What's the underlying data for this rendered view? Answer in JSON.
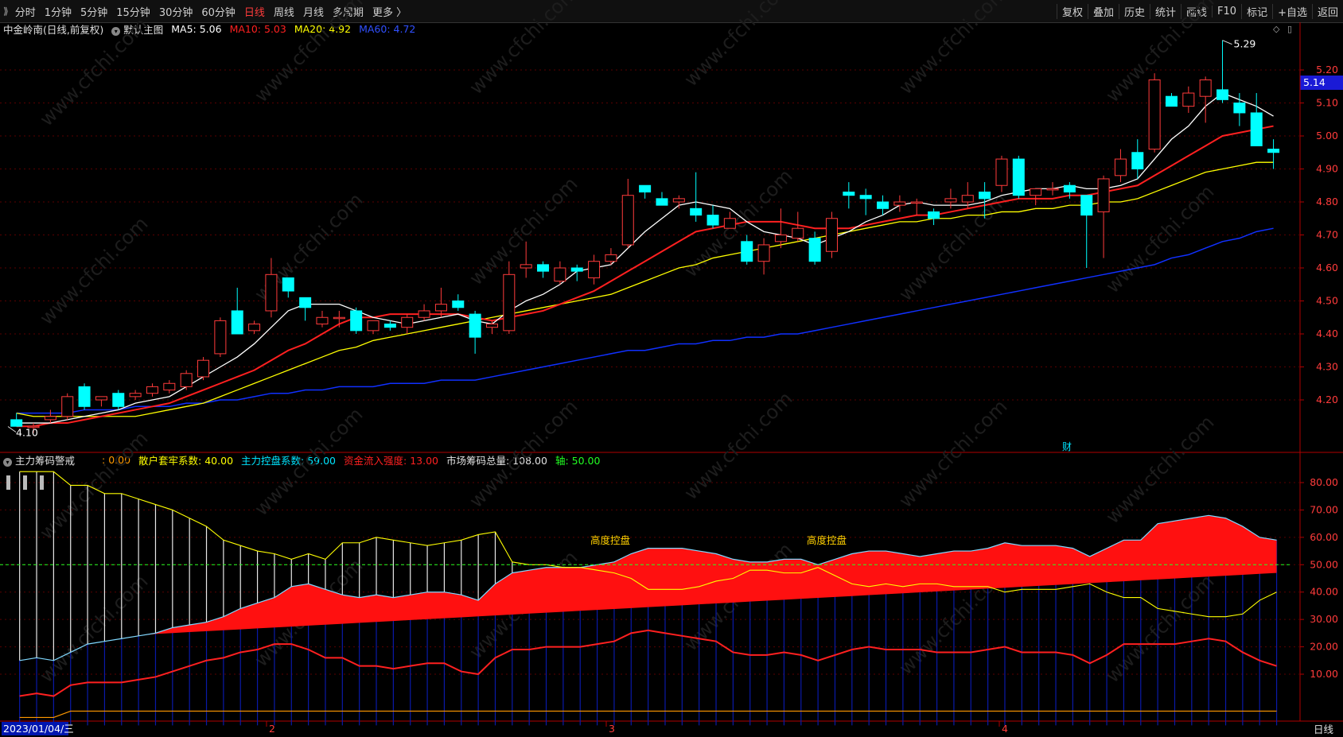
{
  "toolbar": {
    "left": [
      "分时",
      "1分钟",
      "5分钟",
      "15分钟",
      "30分钟",
      "60分钟",
      "日线",
      "周线",
      "月线",
      "多周期",
      "更多 〉"
    ],
    "active_index": 6,
    "right": [
      "复权",
      "叠加",
      "历史",
      "统计",
      "画线",
      "F10",
      "标记",
      "+自选",
      "返回"
    ]
  },
  "main_header": {
    "title": "中金岭南(日线,前复权)",
    "template": "默认主图",
    "ma5": "MA5: 5.06",
    "ma10": "MA10: 5.03",
    "ma20": "MA20: 4.92",
    "ma60": "MA60: 4.72"
  },
  "indicator_header": {
    "name": "主力筹码警戒",
    "v0": ": 0.00",
    "v1": "散户套牢系数: 40.00",
    "v2": "主力控盘系数: 59.00",
    "v3": "资金流入强度: 13.00",
    "v4": "市场筹码总量: 108.00",
    "v5": "轴: 50.00"
  },
  "price_badge": "5.14",
  "high_label": "5.29",
  "low_label": "4.10",
  "finance_marker": "财",
  "annotations": [
    "高度控盘",
    "高度控盘"
  ],
  "x_labels": [
    "2023/01/04/三",
    "2",
    "3",
    "4"
  ],
  "footer_right": "日线",
  "watermark": "www.cfchi.com",
  "colors": {
    "up": "#ff3b3b",
    "down": "#00ffff",
    "ma5": "#ffffff",
    "ma10": "#ff2020",
    "ma20": "#ffff00",
    "ma60": "#1030ff"
  },
  "chart_data": [
    {
      "type": "candlestick",
      "title": "中金岭南(日线,前复权)",
      "y_ticks": [
        4.2,
        4.3,
        4.4,
        4.5,
        4.6,
        4.7,
        4.8,
        4.9,
        5.0,
        5.1,
        5.2
      ],
      "ylim": [
        4.1,
        5.29
      ],
      "ohlc": [
        [
          4.14,
          4.16,
          4.12,
          4.12
        ],
        [
          4.12,
          4.13,
          4.1,
          4.12
        ],
        [
          4.14,
          4.17,
          4.13,
          4.15
        ],
        [
          4.15,
          4.22,
          4.14,
          4.21
        ],
        [
          4.24,
          4.25,
          4.17,
          4.18
        ],
        [
          4.2,
          4.21,
          4.18,
          4.21
        ],
        [
          4.22,
          4.23,
          4.17,
          4.18
        ],
        [
          4.21,
          4.23,
          4.2,
          4.22
        ],
        [
          4.22,
          4.25,
          4.21,
          4.24
        ],
        [
          4.23,
          4.26,
          4.22,
          4.25
        ],
        [
          4.24,
          4.29,
          4.23,
          4.28
        ],
        [
          4.27,
          4.33,
          4.26,
          4.32
        ],
        [
          4.34,
          4.45,
          4.33,
          4.44
        ],
        [
          4.47,
          4.54,
          4.4,
          4.4
        ],
        [
          4.41,
          4.44,
          4.4,
          4.43
        ],
        [
          4.47,
          4.63,
          4.45,
          4.58
        ],
        [
          4.57,
          4.56,
          4.51,
          4.53
        ],
        [
          4.51,
          4.5,
          4.44,
          4.48
        ],
        [
          4.43,
          4.47,
          4.42,
          4.45
        ],
        [
          4.45,
          4.47,
          4.42,
          4.45
        ],
        [
          4.47,
          4.48,
          4.4,
          4.41
        ],
        [
          4.41,
          4.44,
          4.4,
          4.44
        ],
        [
          4.43,
          4.44,
          4.41,
          4.42
        ],
        [
          4.42,
          4.46,
          4.4,
          4.45
        ],
        [
          4.45,
          4.49,
          4.44,
          4.47
        ],
        [
          4.47,
          4.54,
          4.45,
          4.49
        ],
        [
          4.5,
          4.52,
          4.47,
          4.48
        ],
        [
          4.46,
          4.47,
          4.34,
          4.39
        ],
        [
          4.42,
          4.44,
          4.4,
          4.43
        ],
        [
          4.41,
          4.62,
          4.4,
          4.58
        ],
        [
          4.6,
          4.68,
          4.57,
          4.61
        ],
        [
          4.61,
          4.62,
          4.57,
          4.59
        ],
        [
          4.56,
          4.62,
          4.55,
          4.6
        ],
        [
          4.6,
          4.61,
          4.56,
          4.59
        ],
        [
          4.57,
          4.64,
          4.55,
          4.62
        ],
        [
          4.62,
          4.66,
          4.61,
          4.64
        ],
        [
          4.67,
          4.87,
          4.66,
          4.82
        ],
        [
          4.85,
          4.85,
          4.81,
          4.83
        ],
        [
          4.81,
          4.83,
          4.79,
          4.79
        ],
        [
          4.8,
          4.82,
          4.78,
          4.81
        ],
        [
          4.78,
          4.89,
          4.74,
          4.76
        ],
        [
          4.76,
          4.79,
          4.72,
          4.73
        ],
        [
          4.72,
          4.77,
          4.72,
          4.75
        ],
        [
          4.68,
          4.7,
          4.61,
          4.62
        ],
        [
          4.62,
          4.69,
          4.58,
          4.67
        ],
        [
          4.68,
          4.78,
          4.66,
          4.7
        ],
        [
          4.69,
          4.77,
          4.68,
          4.72
        ],
        [
          4.69,
          4.71,
          4.61,
          4.62
        ],
        [
          4.65,
          4.77,
          4.63,
          4.75
        ],
        [
          4.83,
          4.86,
          4.78,
          4.82
        ],
        [
          4.82,
          4.84,
          4.76,
          4.81
        ],
        [
          4.8,
          4.82,
          4.76,
          4.78
        ],
        [
          4.79,
          4.82,
          4.77,
          4.8
        ],
        [
          4.8,
          4.81,
          4.76,
          4.8
        ],
        [
          4.77,
          4.78,
          4.73,
          4.75
        ],
        [
          4.8,
          4.84,
          4.78,
          4.81
        ],
        [
          4.8,
          4.86,
          4.78,
          4.82
        ],
        [
          4.83,
          4.86,
          4.75,
          4.81
        ],
        [
          4.85,
          4.94,
          4.83,
          4.93
        ],
        [
          4.93,
          4.94,
          4.81,
          4.82
        ],
        [
          4.82,
          4.84,
          4.79,
          4.84
        ],
        [
          4.84,
          4.86,
          4.82,
          4.84
        ],
        [
          4.85,
          4.86,
          4.81,
          4.83
        ],
        [
          4.82,
          4.82,
          4.6,
          4.76
        ],
        [
          4.77,
          4.88,
          4.63,
          4.87
        ],
        [
          4.88,
          4.96,
          4.86,
          4.93
        ],
        [
          4.95,
          4.99,
          4.87,
          4.9
        ],
        [
          4.96,
          5.19,
          4.95,
          5.17
        ],
        [
          5.12,
          5.13,
          5.1,
          5.09
        ],
        [
          5.09,
          5.15,
          5.07,
          5.13
        ],
        [
          5.12,
          5.18,
          5.04,
          5.17
        ],
        [
          5.14,
          5.29,
          5.1,
          5.11
        ],
        [
          5.1,
          5.13,
          5.03,
          5.07
        ],
        [
          5.07,
          5.13,
          4.97,
          4.97
        ],
        [
          4.96,
          4.99,
          4.9,
          4.95
        ]
      ],
      "ma5": [
        4.13,
        4.13,
        4.13,
        4.14,
        4.15,
        4.16,
        4.17,
        4.19,
        4.2,
        4.21,
        4.24,
        4.27,
        4.3,
        4.33,
        4.37,
        4.42,
        4.47,
        4.49,
        4.49,
        4.49,
        4.47,
        4.45,
        4.44,
        4.43,
        4.44,
        4.45,
        4.46,
        4.44,
        4.43,
        4.47,
        4.5,
        4.52,
        4.55,
        4.59,
        4.6,
        4.61,
        4.66,
        4.71,
        4.75,
        4.79,
        4.8,
        4.79,
        4.78,
        4.74,
        4.71,
        4.7,
        4.69,
        4.67,
        4.69,
        4.71,
        4.74,
        4.76,
        4.79,
        4.8,
        4.79,
        4.79,
        4.79,
        4.8,
        4.82,
        4.83,
        4.84,
        4.84,
        4.85,
        4.84,
        4.84,
        4.85,
        4.87,
        4.93,
        4.99,
        5.03,
        5.09,
        5.13,
        5.11,
        5.09,
        5.06
      ],
      "ma10": [
        4.12,
        4.12,
        4.13,
        4.13,
        4.14,
        4.15,
        4.16,
        4.17,
        4.18,
        4.19,
        4.21,
        4.23,
        4.25,
        4.27,
        4.29,
        4.32,
        4.35,
        4.37,
        4.4,
        4.43,
        4.45,
        4.45,
        4.46,
        4.46,
        4.46,
        4.46,
        4.46,
        4.45,
        4.44,
        4.45,
        4.46,
        4.47,
        4.49,
        4.51,
        4.53,
        4.56,
        4.59,
        4.62,
        4.65,
        4.68,
        4.71,
        4.72,
        4.73,
        4.74,
        4.74,
        4.74,
        4.73,
        4.72,
        4.72,
        4.72,
        4.73,
        4.74,
        4.75,
        4.76,
        4.76,
        4.77,
        4.78,
        4.79,
        4.8,
        4.81,
        4.81,
        4.81,
        4.82,
        4.82,
        4.83,
        4.84,
        4.85,
        4.88,
        4.91,
        4.94,
        4.97,
        5.0,
        5.01,
        5.02,
        5.03
      ],
      "ma20": [
        4.16,
        4.15,
        4.15,
        4.15,
        4.15,
        4.15,
        4.15,
        4.15,
        4.16,
        4.17,
        4.18,
        4.19,
        4.21,
        4.23,
        4.25,
        4.27,
        4.29,
        4.31,
        4.33,
        4.35,
        4.36,
        4.38,
        4.39,
        4.4,
        4.41,
        4.42,
        4.43,
        4.44,
        4.45,
        4.46,
        4.47,
        4.48,
        4.49,
        4.5,
        4.51,
        4.52,
        4.54,
        4.56,
        4.58,
        4.6,
        4.61,
        4.63,
        4.64,
        4.65,
        4.66,
        4.67,
        4.68,
        4.69,
        4.7,
        4.71,
        4.72,
        4.73,
        4.74,
        4.74,
        4.75,
        4.75,
        4.76,
        4.76,
        4.77,
        4.77,
        4.78,
        4.78,
        4.79,
        4.79,
        4.8,
        4.8,
        4.81,
        4.83,
        4.85,
        4.87,
        4.89,
        4.9,
        4.91,
        4.92,
        4.92
      ],
      "ma60": [
        4.16,
        4.16,
        4.16,
        4.16,
        4.17,
        4.17,
        4.17,
        4.18,
        4.18,
        4.18,
        4.19,
        4.19,
        4.2,
        4.2,
        4.21,
        4.22,
        4.22,
        4.23,
        4.23,
        4.24,
        4.24,
        4.24,
        4.25,
        4.25,
        4.25,
        4.26,
        4.26,
        4.26,
        4.27,
        4.28,
        4.29,
        4.3,
        4.31,
        4.32,
        4.33,
        4.34,
        4.35,
        4.35,
        4.36,
        4.37,
        4.37,
        4.38,
        4.38,
        4.39,
        4.39,
        4.4,
        4.4,
        4.41,
        4.42,
        4.43,
        4.44,
        4.45,
        4.46,
        4.47,
        4.48,
        4.49,
        4.5,
        4.51,
        4.52,
        4.53,
        4.54,
        4.55,
        4.56,
        4.57,
        4.58,
        4.59,
        4.6,
        4.61,
        4.63,
        4.64,
        4.66,
        4.68,
        4.69,
        4.71,
        4.72
      ]
    },
    {
      "type": "area",
      "title": "主力筹码警戒",
      "y_ticks": [
        10,
        20,
        30,
        40,
        50,
        60,
        70,
        80
      ],
      "ylim": [
        0,
        90
      ],
      "axis_line": 50,
      "retail_trap": [
        15,
        16,
        15,
        18,
        21,
        22,
        23,
        24,
        25,
        27,
        28,
        29,
        31,
        34,
        36,
        38,
        42,
        43,
        41,
        39,
        38,
        39,
        38,
        39,
        40,
        40,
        39,
        37,
        43,
        47,
        48,
        49,
        49,
        49,
        50,
        51,
        54,
        56,
        56,
        56,
        55,
        54,
        52,
        51,
        51,
        52,
        52,
        50,
        52,
        54,
        55,
        55,
        54,
        53,
        54,
        55,
        55,
        56,
        58,
        57,
        57,
        57,
        56,
        53,
        56,
        59,
        59,
        65,
        66,
        67,
        68,
        67,
        64,
        60,
        59
      ],
      "main_control": [
        84,
        84,
        84,
        79,
        79,
        76,
        76,
        74,
        72,
        70,
        67,
        64,
        59,
        57,
        55,
        54,
        52,
        54,
        52,
        58,
        58,
        60,
        59,
        58,
        57,
        58,
        59,
        61,
        62,
        51,
        50,
        50,
        49,
        49,
        48,
        47,
        45,
        41,
        41,
        41,
        42,
        44,
        45,
        48,
        48,
        47,
        47,
        49,
        46,
        43,
        42,
        43,
        42,
        43,
        43,
        42,
        42,
        42,
        40,
        41,
        41,
        41,
        42,
        43,
        40,
        38,
        38,
        34,
        33,
        32,
        31,
        31,
        32,
        37,
        40
      ],
      "inflow_strength": [
        2,
        3,
        2,
        6,
        7,
        7,
        7,
        8,
        9,
        11,
        13,
        15,
        16,
        18,
        19,
        21,
        21,
        19,
        16,
        16,
        13,
        13,
        12,
        13,
        14,
        14,
        11,
        10,
        16,
        19,
        19,
        20,
        20,
        20,
        21,
        22,
        25,
        26,
        25,
        24,
        23,
        22,
        18,
        17,
        17,
        18,
        17,
        15,
        17,
        19,
        20,
        19,
        19,
        19,
        18,
        18,
        18,
        19,
        20,
        18,
        18,
        18,
        17,
        14,
        17,
        21,
        21,
        21,
        21,
        22,
        23,
        22,
        18,
        15,
        13
      ],
      "market_total": [
        8,
        8,
        8,
        9,
        9,
        9,
        9,
        9,
        9,
        9,
        9,
        9,
        9,
        9,
        9,
        9,
        9,
        9,
        9,
        9,
        9,
        9,
        9,
        9,
        9,
        9,
        9,
        9,
        9,
        9,
        9,
        9,
        9,
        9,
        9,
        9,
        9,
        9,
        9,
        9,
        9,
        9,
        9,
        9,
        9,
        9,
        9,
        9,
        9,
        9,
        9,
        9,
        9,
        9,
        9,
        9,
        9,
        9,
        9,
        9,
        9,
        9,
        9,
        9,
        9,
        9,
        9,
        9,
        9,
        9,
        9,
        9,
        9,
        9,
        9
      ]
    }
  ]
}
